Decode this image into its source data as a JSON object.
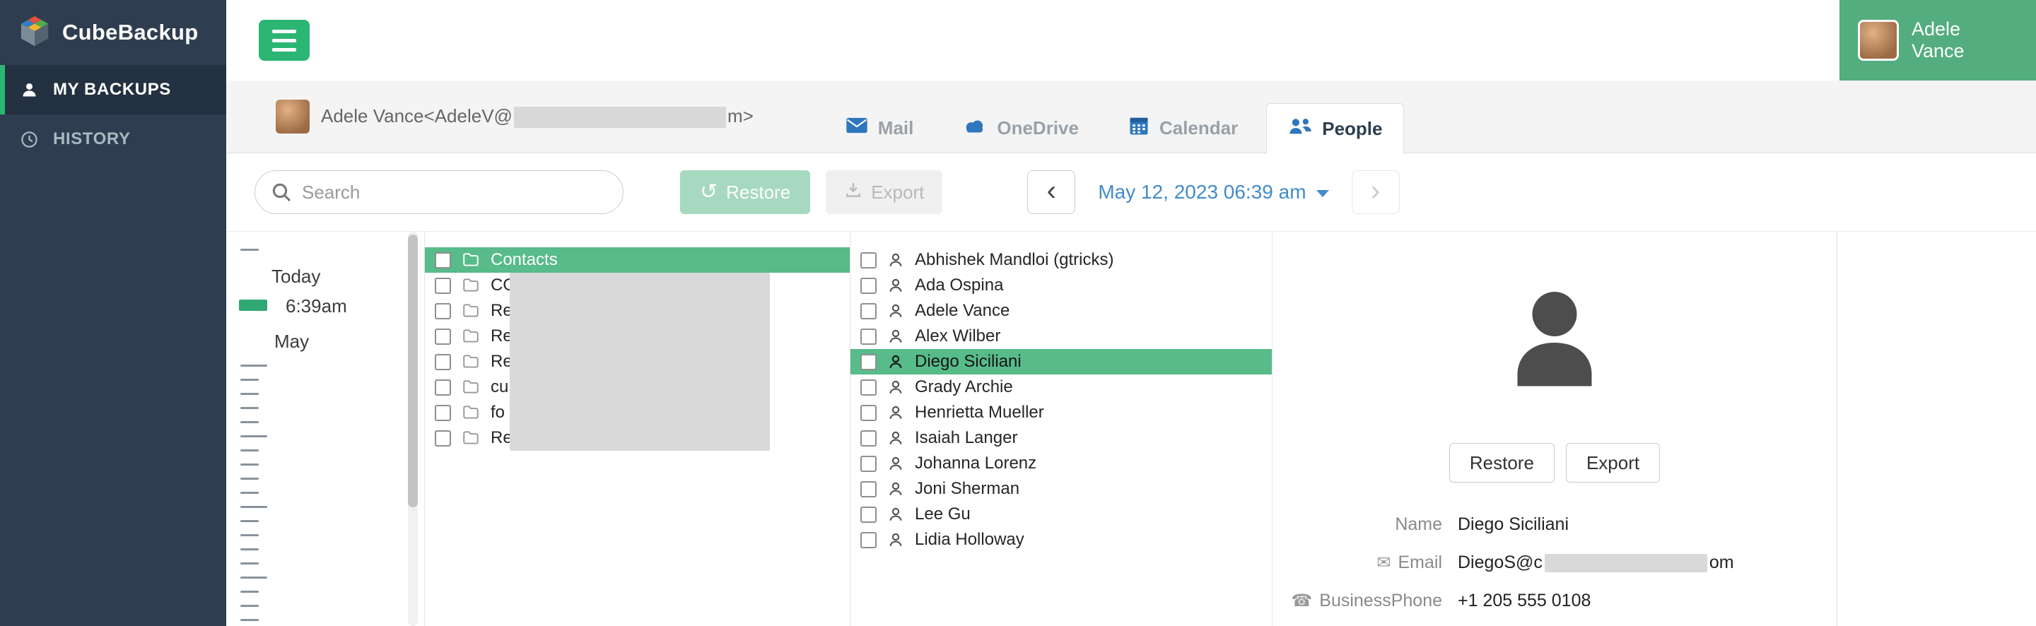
{
  "app": {
    "brand": "CubeBackup"
  },
  "sidebar": {
    "items": [
      {
        "label": "MY BACKUPS",
        "icon": "user",
        "active": true
      },
      {
        "label": "HISTORY",
        "icon": "clock",
        "active": false
      }
    ]
  },
  "topbar": {
    "user_name": "Adele Vance"
  },
  "account_tab": {
    "email_prefix": "Adele Vance<AdeleV@",
    "email_suffix": "m>",
    "redacted": true
  },
  "tabs": {
    "items": [
      {
        "label": "Mail",
        "active": false
      },
      {
        "label": "OneDrive",
        "active": false
      },
      {
        "label": "Calendar",
        "active": false
      },
      {
        "label": "People",
        "active": true
      }
    ]
  },
  "toolbar": {
    "search_placeholder": "Search",
    "restore_label": "Restore",
    "export_label": "Export",
    "prev_label": "‹",
    "next_label": "›",
    "date_label": "May 12, 2023 06:39 am"
  },
  "timeline": {
    "today": "Today",
    "time": "6:39am",
    "month": "May"
  },
  "folders": {
    "items": [
      {
        "label": "Contacts",
        "selected": true
      },
      {
        "label": "CO",
        "redacted": true
      },
      {
        "label": "Re",
        "redacted": true
      },
      {
        "label": "Re",
        "redacted": true
      },
      {
        "label": "Re",
        "redacted": true
      },
      {
        "label": "cu",
        "redacted": true
      },
      {
        "label": "fo",
        "redacted": true
      },
      {
        "label": "Re",
        "redacted": true
      }
    ]
  },
  "contacts": {
    "items": [
      {
        "name": "Abhishek Mandloi (gtricks)"
      },
      {
        "name": "Ada Ospina"
      },
      {
        "name": "Adele Vance"
      },
      {
        "name": "Alex Wilber"
      },
      {
        "name": "Diego Siciliani",
        "selected": true
      },
      {
        "name": "Grady Archie"
      },
      {
        "name": "Henrietta Mueller"
      },
      {
        "name": "Isaiah Langer"
      },
      {
        "name": "Johanna Lorenz"
      },
      {
        "name": "Joni Sherman"
      },
      {
        "name": "Lee Gu"
      },
      {
        "name": "Lidia Holloway"
      }
    ]
  },
  "detail": {
    "restore_label": "Restore",
    "export_label": "Export",
    "fields": [
      {
        "label": "Name",
        "value": "Diego Siciliani"
      },
      {
        "label": "Email",
        "icon_glyph": "✉",
        "value_prefix": "DiegoS@c",
        "value_suffix": "om",
        "redacted": true
      },
      {
        "label": "BusinessPhone",
        "icon_glyph": "☎",
        "value": "+1 205 555 0108"
      }
    ]
  },
  "colors": {
    "accent_green": "#2bb673",
    "highlight_green": "#57bb8a",
    "chip_green": "#53ad7e",
    "sidebar_navy": "#2e3d4f",
    "link_blue": "#428bca",
    "tab_icon_blue": "#2e77bc",
    "redaction_gray": "#d9d9d9"
  }
}
